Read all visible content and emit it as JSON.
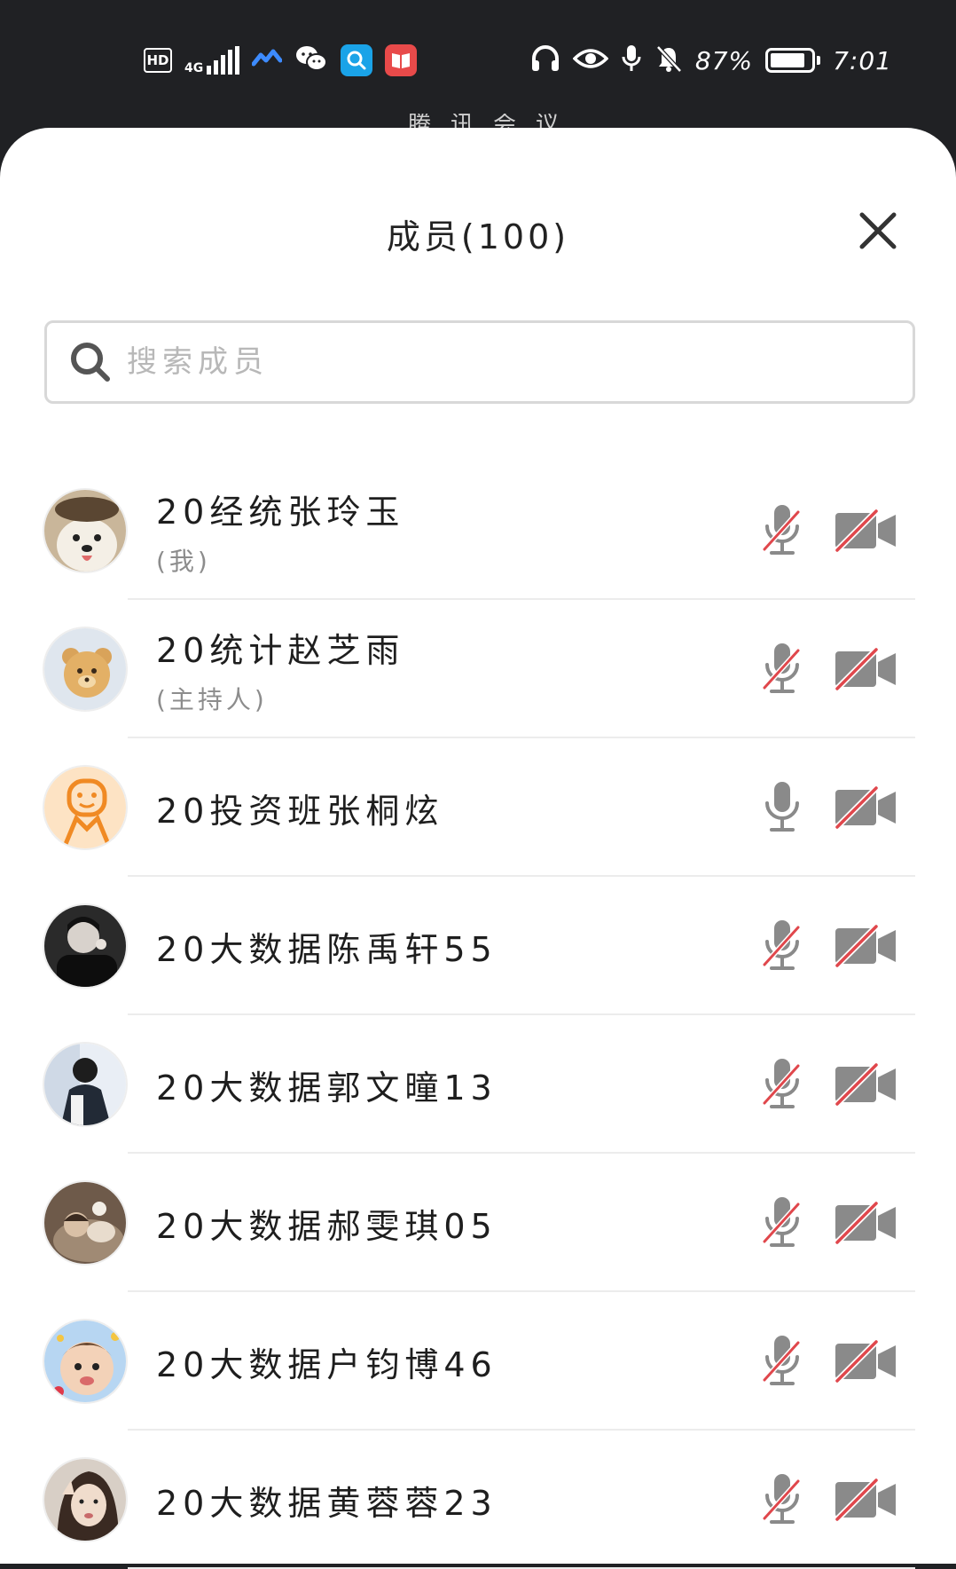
{
  "status_bar": {
    "hd_label": "HD",
    "network_label": "4G",
    "battery_text": "87%",
    "battery_level": 0.87,
    "time": "7:01",
    "left_icons": [
      "hd-icon",
      "signal-icon",
      "cloud-sync-icon",
      "wechat-icon",
      "search-app-icon",
      "book-app-icon"
    ],
    "right_icons": [
      "headphones-icon",
      "eye-icon",
      "microphone-icon",
      "bell-muted-icon",
      "battery-icon"
    ]
  },
  "background_title": "腾讯会议",
  "sheet": {
    "title": "成员(100)",
    "close_icon": "close-icon"
  },
  "search": {
    "placeholder": "搜索成员",
    "value": ""
  },
  "members": [
    {
      "name": "20经统张玲玉",
      "role": "(我)",
      "avatar": "samoyed-dog-avatar",
      "mic_muted": true,
      "camera_off": true
    },
    {
      "name": "20统计赵芝雨",
      "role": "(主持人)",
      "avatar": "teddy-bear-avatar",
      "mic_muted": true,
      "camera_off": true
    },
    {
      "name": "20投资班张桐炫",
      "role": "",
      "avatar": "default-person-avatar",
      "mic_muted": false,
      "camera_off": true
    },
    {
      "name": "20大数据陈禹轩55",
      "role": "",
      "avatar": "dark-photo-avatar",
      "mic_muted": true,
      "camera_off": true
    },
    {
      "name": "20大数据郭文曈13",
      "role": "",
      "avatar": "person-photo-avatar",
      "mic_muted": true,
      "camera_off": true
    },
    {
      "name": "20大数据郝雯琪05",
      "role": "",
      "avatar": "sleeping-photo-avatar",
      "mic_muted": true,
      "camera_off": true
    },
    {
      "name": "20大数据户钧博46",
      "role": "",
      "avatar": "baby-photo-avatar",
      "mic_muted": true,
      "camera_off": true
    },
    {
      "name": "20大数据黄蓉蓉23",
      "role": "",
      "avatar": "girl-photo-avatar",
      "mic_muted": true,
      "camera_off": true
    }
  ],
  "colors": {
    "status_bar_bg": "#202124",
    "sheet_bg": "#ffffff",
    "icon_gray": "#8a8a8a",
    "muted_slash": "#e0474c",
    "divider": "#ececec"
  }
}
